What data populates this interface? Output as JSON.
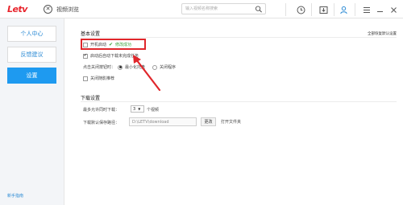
{
  "app": {
    "logo": "Letv"
  },
  "titlebar": {
    "nav_label": "视频浏览",
    "search_placeholder": "输入视频名称搜索"
  },
  "sidebar": {
    "items": [
      {
        "label": "个人中心"
      },
      {
        "label": "反馈建议"
      },
      {
        "label": "设置"
      }
    ],
    "footer": "新手指南"
  },
  "basic": {
    "title": "基本设置",
    "restore_label": "全部恢复默认设置",
    "autostart_label": "开机启动",
    "success_label": "修改成功",
    "autodownload_label": "启动后自动下载未完成任务",
    "close_prompt": "点击关闭按钮时：",
    "radio_minimize": "最小化托盘",
    "radio_exit": "关闭程序",
    "recommend_label": "关闭随影推荐"
  },
  "download": {
    "title": "下载设置",
    "max_label": "最多允许同时下载：",
    "max_value": "3",
    "max_unit": "个视频",
    "path_label": "下载默认保存路径：",
    "path_value": "D:\\LETV\\download",
    "change_btn": "更改",
    "open_folder": "打开文件夹"
  },
  "colors": {
    "brand": "#e8242c",
    "accent": "#1e9af0",
    "success": "#3ba33b",
    "annotation": "#e0262b"
  }
}
